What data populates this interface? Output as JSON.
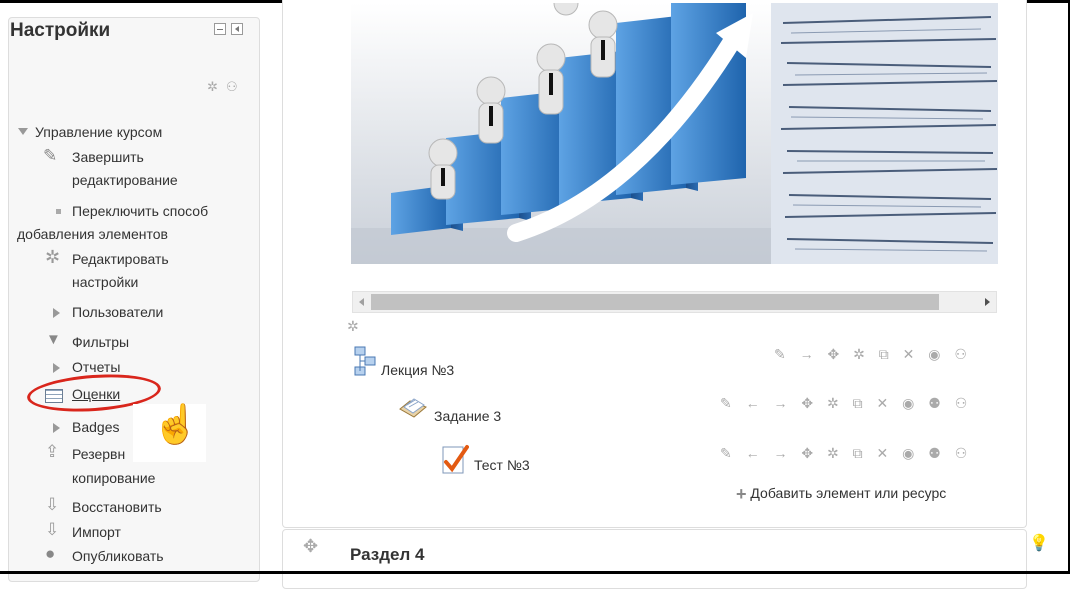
{
  "settings": {
    "title": "Настройки",
    "items": {
      "course_admin": "Управление курсом",
      "finish_editing_1": "Завершить",
      "finish_editing_2": "редактирование",
      "switch_mode_1": "Переключить способ",
      "switch_mode_2": "добавления элементов",
      "edit_settings_1": "Редактировать",
      "edit_settings_2": "настройки",
      "users": "Пользователи",
      "filters": "Фильтры",
      "reports": "Отчеты",
      "grades": "Оценки",
      "badges": "Badges",
      "backup_1": "Резервн",
      "backup_2": "копирование",
      "restore": "Восстановить",
      "import": "Импорт",
      "publish": "Опубликовать"
    }
  },
  "activities": [
    {
      "label": "Лекция №3",
      "icon": "lesson-icon"
    },
    {
      "label": "Задание 3",
      "icon": "assignment-icon"
    },
    {
      "label": "Тест №3",
      "icon": "quiz-icon"
    }
  ],
  "edit_icons": {
    "row1": "✎ → ✥ ✲ ⧉ ✕ ◉ ⚇",
    "row2": "✎ ← → ✥ ✲ ⧉ ✕ ◉ ⚉ ⚇",
    "row3": "✎ ← → ✥ ✲ ⧉ ✕ ◉ ⚉ ⚇"
  },
  "add_resource": "Добавить элемент или ресурс",
  "section": {
    "title": "Раздел 4"
  },
  "colors": {
    "highlight": "#d9261c",
    "bar_blue": "#2f7fc8"
  }
}
